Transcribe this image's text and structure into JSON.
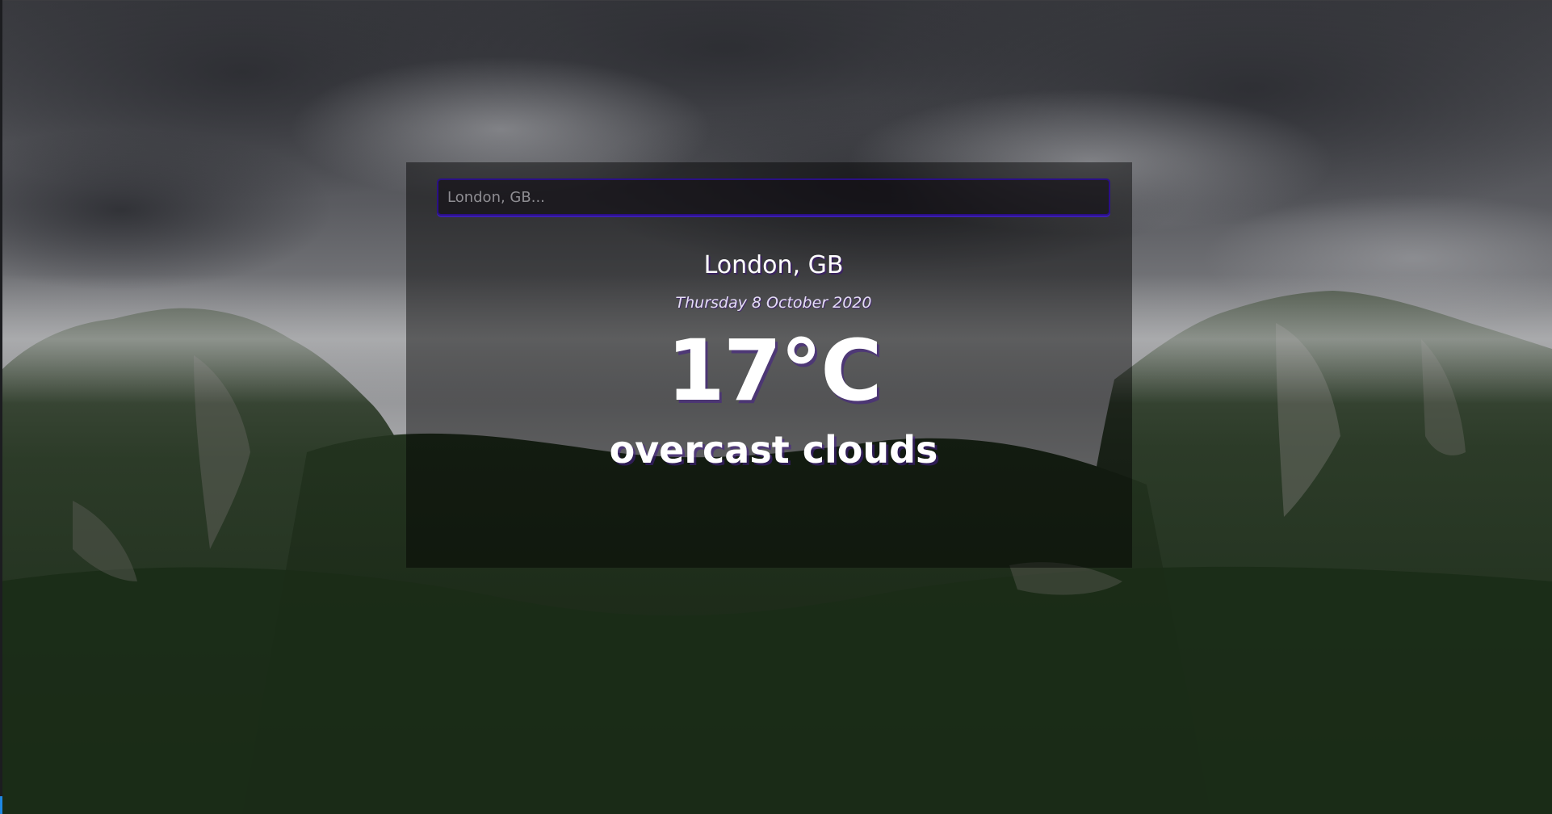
{
  "search": {
    "placeholder": "London, GB...",
    "value": ""
  },
  "weather": {
    "location": "London, GB",
    "date": "Thursday 8 October 2020",
    "temperature": "17°C",
    "condition": "overcast clouds"
  },
  "colors": {
    "input_border": "#2a0f86",
    "text_shadow": "#46228c",
    "panel_overlay": "rgba(0,0,0,0.45)"
  }
}
